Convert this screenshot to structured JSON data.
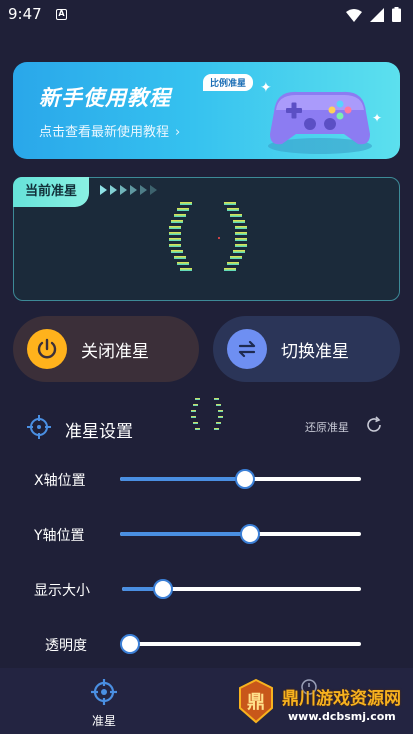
{
  "status_bar": {
    "time": "9:47",
    "notification_letter": "A"
  },
  "banner": {
    "title": "新手使用教程",
    "tag": "比例准星",
    "subtitle": "点击查看最新使用教程",
    "chevron": "›"
  },
  "current_panel": {
    "label": "当前准星",
    "arrow_count": 6
  },
  "buttons": {
    "close_label": "关闭准星",
    "switch_label": "切换准星"
  },
  "settings": {
    "title": "准星设置",
    "reset_label": "还原准星",
    "sliders": [
      {
        "label": "X轴位置",
        "value": 0.52
      },
      {
        "label": "Y轴位置",
        "value": 0.54
      },
      {
        "label": "显示大小",
        "value": 0.17
      },
      {
        "label": "透明度",
        "value": 0.0
      }
    ]
  },
  "bottom_nav": {
    "tab1_label": "准星"
  },
  "watermark": {
    "logo_text": "鼎",
    "text": "鼎川游戏资源网",
    "url": "www.dcbsmj.com"
  },
  "colors": {
    "background": "#1f2038",
    "accent_blue": "#4a8fe2",
    "accent_teal": "#66e2d9",
    "power_yellow": "#ffb21c",
    "switch_blue": "#6e8ff2",
    "watermark_gold": "#f7b21f"
  },
  "icons": {
    "status": [
      "wifi-icon",
      "signal-icon",
      "battery-icon"
    ],
    "settings": "crosshair-icon",
    "reset": "refresh-icon",
    "close_button": "power-icon",
    "switch_button": "swap-arrows-icon"
  }
}
